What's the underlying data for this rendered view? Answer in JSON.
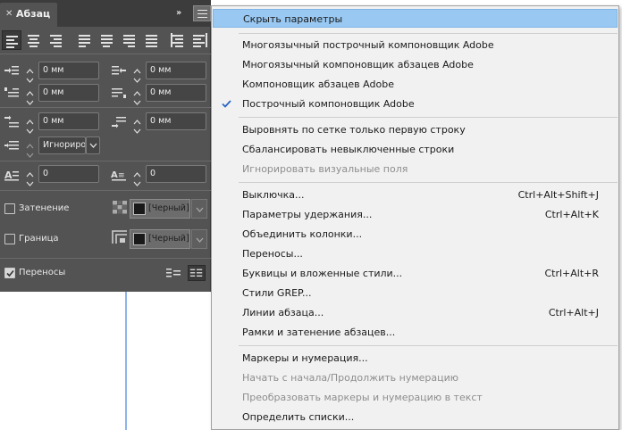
{
  "panel": {
    "title": "Абзац",
    "fields": {
      "left_indent": "0 мм",
      "right_indent": "0 мм",
      "first_line_indent": "0 мм",
      "last_line_indent": "0 мм",
      "space_before": "0 мм",
      "space_after": "0 мм",
      "align_to_grid": "Игнориро",
      "drop_cap_lines": "0",
      "drop_cap_chars": "0"
    },
    "shading": {
      "label": "Затенение",
      "color_label": "[Черный]",
      "checked": false
    },
    "border": {
      "label": "Граница",
      "color_label": "[Черный]",
      "checked": false
    },
    "hyphenation": {
      "label": "Переносы",
      "checked": true
    }
  },
  "menu": {
    "items": [
      {
        "label": "Скрыть параметры",
        "shortcut": "",
        "highlighted": true
      },
      {
        "label": "Многоязычный построчный компоновщик Adobe",
        "shortcut": ""
      },
      {
        "label": "Многоязычный компоновщик абзацев Adobe",
        "shortcut": ""
      },
      {
        "label": "Компоновщик абзацев Adobe",
        "shortcut": ""
      },
      {
        "label": "Построчный компоновщик Adobe",
        "shortcut": "",
        "checked": true
      },
      {
        "label": "Выровнять по сетке только первую строку",
        "shortcut": ""
      },
      {
        "label": "Сбалансировать невыключенные строки",
        "shortcut": ""
      },
      {
        "label": "Игнорировать визуальные поля",
        "shortcut": "",
        "disabled": true
      },
      {
        "label": "Выключка...",
        "shortcut": "Ctrl+Alt+Shift+J"
      },
      {
        "label": "Параметры удержания...",
        "shortcut": "Ctrl+Alt+K"
      },
      {
        "label": "Объединить колонки...",
        "shortcut": ""
      },
      {
        "label": "Переносы...",
        "shortcut": ""
      },
      {
        "label": "Буквицы и вложенные стили...",
        "shortcut": "Ctrl+Alt+R"
      },
      {
        "label": "Стили GREP...",
        "shortcut": ""
      },
      {
        "label": "Линии абзаца...",
        "shortcut": "Ctrl+Alt+J"
      },
      {
        "label": "Рамки и затенение абзацев...",
        "shortcut": ""
      },
      {
        "label": "Маркеры и нумерация...",
        "shortcut": ""
      },
      {
        "label": "Начать с начала/Продолжить нумерацию",
        "shortcut": "",
        "disabled": true
      },
      {
        "label": "Преобразовать маркеры и нумерацию в текст",
        "shortcut": "",
        "disabled": true
      },
      {
        "label": "Определить списки...",
        "shortcut": ""
      }
    ]
  },
  "colors": {
    "panel_bg": "#535353",
    "panel_header": "#3c3c3c",
    "menu_bg": "#f1f1f1",
    "menu_highlight": "#99c9f3",
    "guide": "#8db4e8"
  },
  "icons": {
    "tab_close": "close-icon",
    "collapse": "double-chevron-right-icon",
    "panel_menu": "hamburger-menu-icon",
    "check": "checkmark-icon"
  }
}
